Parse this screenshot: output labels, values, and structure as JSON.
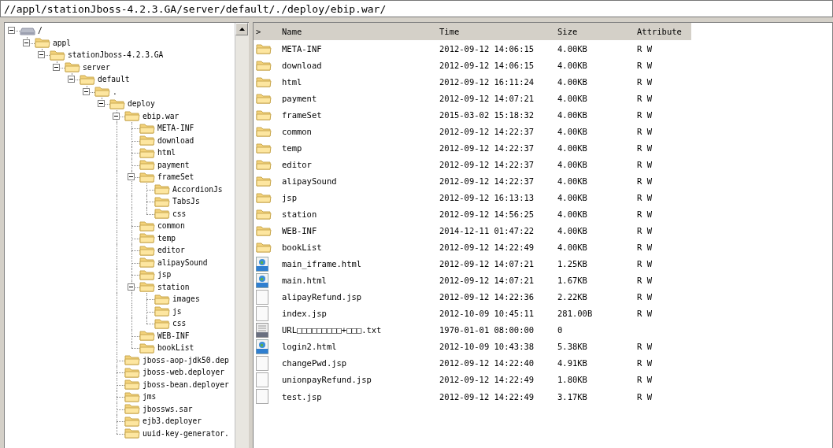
{
  "address_bar": {
    "value": "//appl/stationJboss-4.2.3.GA/server/default/./deploy/ebip.war/"
  },
  "tree": {
    "items": [
      {
        "label": "/",
        "kind": "drive",
        "expanded": true,
        "children": [
          {
            "label": "appl",
            "kind": "folder",
            "expanded": true,
            "children": [
              {
                "label": "stationJboss-4.2.3.GA",
                "kind": "folder",
                "expanded": true,
                "children": [
                  {
                    "label": "server",
                    "kind": "folder",
                    "expanded": true,
                    "children": [
                      {
                        "label": "default",
                        "kind": "folder",
                        "expanded": true,
                        "children": [
                          {
                            "label": ".",
                            "kind": "folder",
                            "expanded": true,
                            "children": [
                              {
                                "label": "deploy",
                                "kind": "folder",
                                "expanded": true,
                                "children": [
                                  {
                                    "label": "ebip.war",
                                    "kind": "folder",
                                    "expanded": true,
                                    "children": [
                                      {
                                        "label": "META-INF",
                                        "kind": "folder"
                                      },
                                      {
                                        "label": "download",
                                        "kind": "folder"
                                      },
                                      {
                                        "label": "html",
                                        "kind": "folder"
                                      },
                                      {
                                        "label": "payment",
                                        "kind": "folder"
                                      },
                                      {
                                        "label": "frameSet",
                                        "kind": "folder",
                                        "expanded": true,
                                        "children": [
                                          {
                                            "label": "AccordionJs",
                                            "kind": "folder"
                                          },
                                          {
                                            "label": "TabsJs",
                                            "kind": "folder"
                                          },
                                          {
                                            "label": "css",
                                            "kind": "folder"
                                          }
                                        ]
                                      },
                                      {
                                        "label": "common",
                                        "kind": "folder"
                                      },
                                      {
                                        "label": "temp",
                                        "kind": "folder"
                                      },
                                      {
                                        "label": "editor",
                                        "kind": "folder"
                                      },
                                      {
                                        "label": "alipaySound",
                                        "kind": "folder"
                                      },
                                      {
                                        "label": "jsp",
                                        "kind": "folder"
                                      },
                                      {
                                        "label": "station",
                                        "kind": "folder",
                                        "expanded": true,
                                        "children": [
                                          {
                                            "label": "images",
                                            "kind": "folder"
                                          },
                                          {
                                            "label": "js",
                                            "kind": "folder"
                                          },
                                          {
                                            "label": "css",
                                            "kind": "folder"
                                          }
                                        ]
                                      },
                                      {
                                        "label": "WEB-INF",
                                        "kind": "folder"
                                      },
                                      {
                                        "label": "bookList",
                                        "kind": "folder"
                                      }
                                    ]
                                  },
                                  {
                                    "label": "jboss-aop-jdk50.dep",
                                    "kind": "folder"
                                  },
                                  {
                                    "label": "jboss-web.deployer",
                                    "kind": "folder"
                                  },
                                  {
                                    "label": "jboss-bean.deployer",
                                    "kind": "folder"
                                  },
                                  {
                                    "label": "jms",
                                    "kind": "folder"
                                  },
                                  {
                                    "label": "jbossws.sar",
                                    "kind": "folder"
                                  },
                                  {
                                    "label": "ejb3.deployer",
                                    "kind": "folder"
                                  },
                                  {
                                    "label": "uuid-key-generator.",
                                    "kind": "folder"
                                  }
                                ]
                              }
                            ]
                          }
                        ]
                      }
                    ]
                  }
                ]
              }
            ]
          }
        ]
      }
    ]
  },
  "table": {
    "sort_mark": ">",
    "columns": [
      "Name",
      "Time",
      "Size",
      "Attribute"
    ],
    "rows": [
      {
        "kind": "folder",
        "name": "META-INF",
        "time": "2012-09-12 14:06:15",
        "size": "4.00KB",
        "attribute": "R W"
      },
      {
        "kind": "folder",
        "name": "download",
        "time": "2012-09-12 14:06:15",
        "size": "4.00KB",
        "attribute": "R W"
      },
      {
        "kind": "folder",
        "name": "html",
        "time": "2012-09-12 16:11:24",
        "size": "4.00KB",
        "attribute": "R W"
      },
      {
        "kind": "folder",
        "name": "payment",
        "time": "2012-09-12 14:07:21",
        "size": "4.00KB",
        "attribute": "R W"
      },
      {
        "kind": "folder",
        "name": "frameSet",
        "time": "2015-03-02 15:18:32",
        "size": "4.00KB",
        "attribute": "R W"
      },
      {
        "kind": "folder",
        "name": "common",
        "time": "2012-09-12 14:22:37",
        "size": "4.00KB",
        "attribute": "R W"
      },
      {
        "kind": "folder",
        "name": "temp",
        "time": "2012-09-12 14:22:37",
        "size": "4.00KB",
        "attribute": "R W"
      },
      {
        "kind": "folder",
        "name": "editor",
        "time": "2012-09-12 14:22:37",
        "size": "4.00KB",
        "attribute": "R W"
      },
      {
        "kind": "folder",
        "name": "alipaySound",
        "time": "2012-09-12 14:22:37",
        "size": "4.00KB",
        "attribute": "R W"
      },
      {
        "kind": "folder",
        "name": "jsp",
        "time": "2012-09-12 16:13:13",
        "size": "4.00KB",
        "attribute": "R W"
      },
      {
        "kind": "folder",
        "name": "station",
        "time": "2012-09-12 14:56:25",
        "size": "4.00KB",
        "attribute": "R W"
      },
      {
        "kind": "folder",
        "name": "WEB-INF",
        "time": "2014-12-11 01:47:22",
        "size": "4.00KB",
        "attribute": "R W"
      },
      {
        "kind": "folder",
        "name": "bookList",
        "time": "2012-09-12 14:22:49",
        "size": "4.00KB",
        "attribute": "R W"
      },
      {
        "kind": "html",
        "name": "main_iframe.html",
        "time": "2012-09-12 14:07:21",
        "size": "1.25KB",
        "attribute": "R W"
      },
      {
        "kind": "html",
        "name": "main.html",
        "time": "2012-09-12 14:07:21",
        "size": "1.67KB",
        "attribute": "R W"
      },
      {
        "kind": "file",
        "name": "alipayRefund.jsp",
        "time": "2012-09-12 14:22:36",
        "size": "2.22KB",
        "attribute": "R W"
      },
      {
        "kind": "file",
        "name": "index.jsp",
        "time": "2012-10-09 10:45:11",
        "size": "281.00B",
        "attribute": "R W"
      },
      {
        "kind": "txt",
        "name": "URL□□□□□□□□□+□□□.txt",
        "time": "1970-01-01 08:00:00",
        "size": "0"
      },
      {
        "kind": "html",
        "name": "login2.html",
        "time": "2012-10-09 10:43:38",
        "size": "5.38KB",
        "attribute": "R W"
      },
      {
        "kind": "file",
        "name": "changePwd.jsp",
        "time": "2012-09-12 14:22:40",
        "size": "4.91KB",
        "attribute": "R W"
      },
      {
        "kind": "file",
        "name": "unionpayRefund.jsp",
        "time": "2012-09-12 14:22:49",
        "size": "1.80KB",
        "attribute": "R W"
      },
      {
        "kind": "file",
        "name": "test.jsp",
        "time": "2012-09-12 14:22:49",
        "size": "3.17KB",
        "attribute": "R W"
      }
    ]
  }
}
